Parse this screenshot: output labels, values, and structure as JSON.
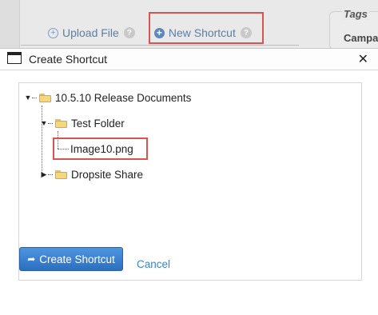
{
  "background": {
    "upload_file_label": "Upload File",
    "new_shortcut_label": "New Shortcut",
    "tags_title": "Tags",
    "tags_first_item": "Campa",
    "help_glyph": "?"
  },
  "dialog": {
    "title": "Create Shortcut",
    "close_glyph": "✕",
    "tree": {
      "root": "10.5.10 Release Documents",
      "child_folder": "Test Folder",
      "selected_file": "Image10.png",
      "sibling_folder": "Dropsite Share"
    },
    "create_button_label": "Create Shortcut",
    "cancel_label": "Cancel"
  },
  "colors": {
    "highlight_red": "#d9534f",
    "primary_blue": "#2b6fbf",
    "link_blue": "#3b86c8",
    "folder_yellow": "#f5d77f"
  },
  "icons": {
    "upload": "plus-circle-outline-icon",
    "new_shortcut": "plus-circle-filled-icon",
    "help": "question-circle-icon",
    "window": "window-icon",
    "folder": "folder-icon",
    "share": "share-arrow-icon"
  }
}
